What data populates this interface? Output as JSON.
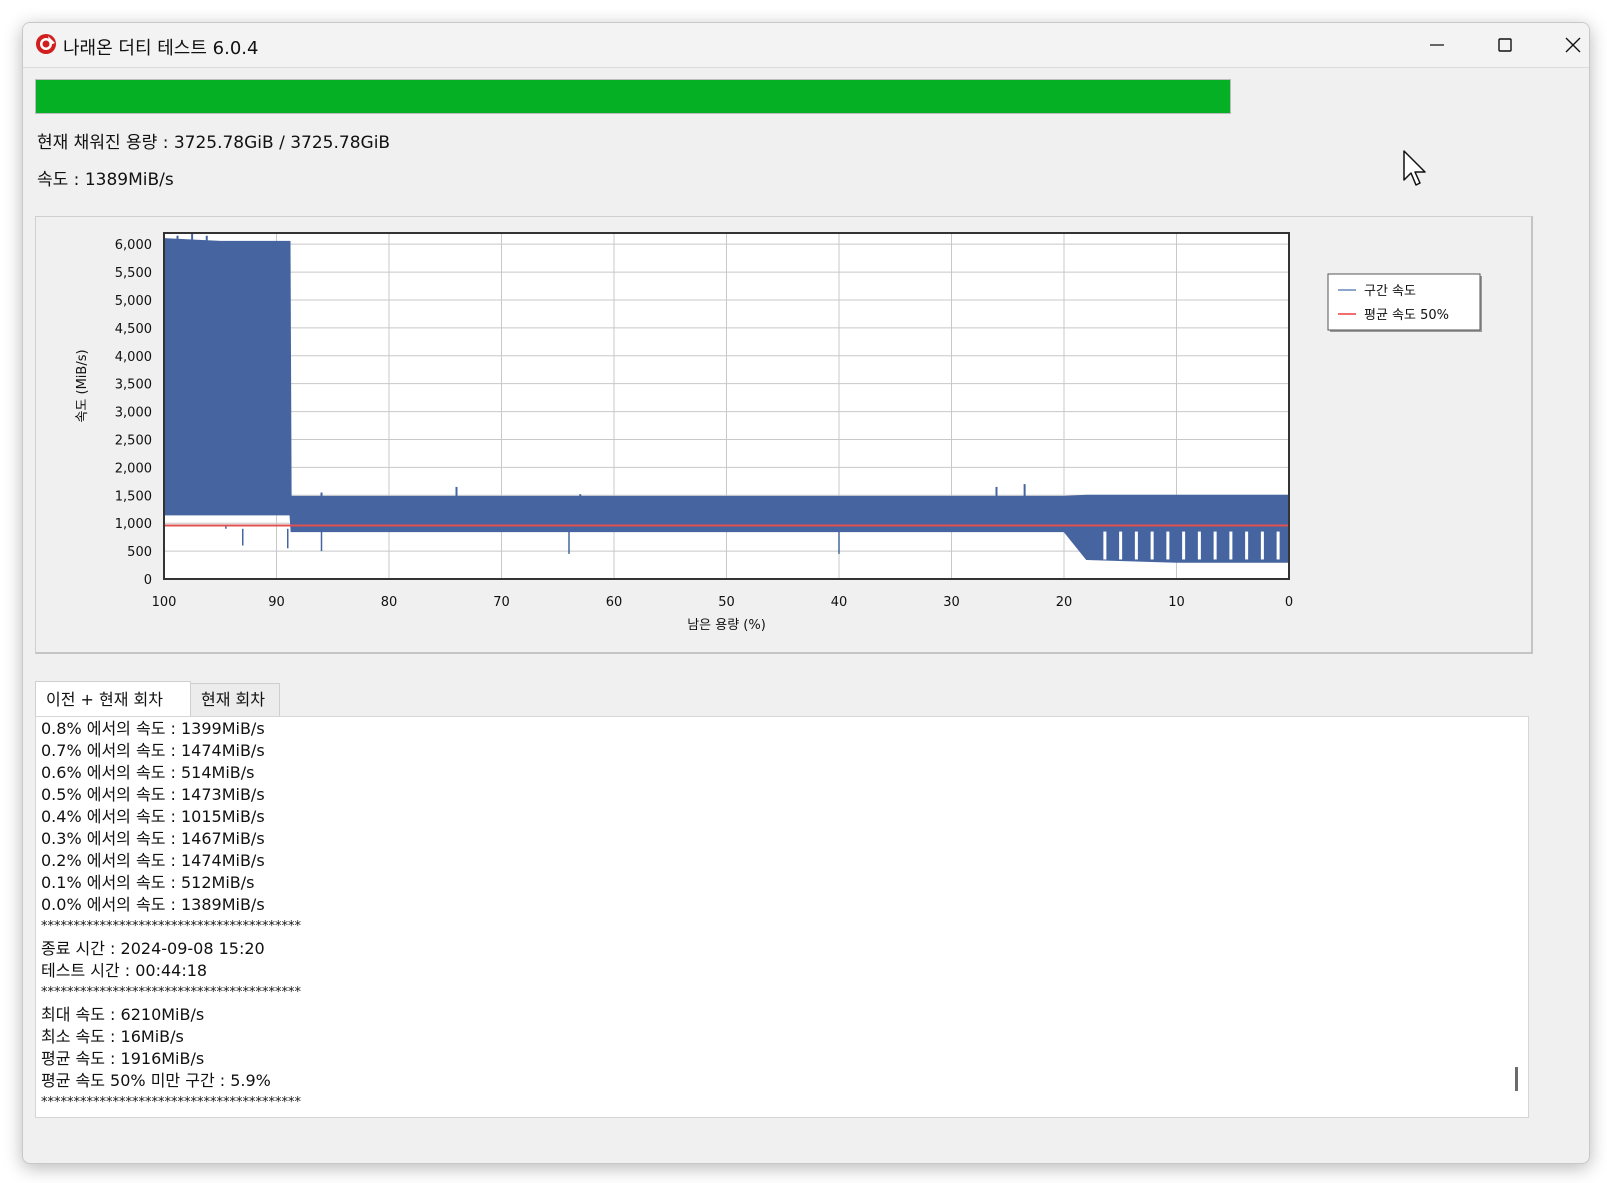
{
  "window": {
    "title": "나래온 더티 테스트 6.0.4"
  },
  "progress": {
    "value_fraction": 1.0,
    "color": "#06b025"
  },
  "info": {
    "capacity": "현재 채워진 용량 : 3725.78GiB / 3725.78GiB",
    "speed": "속도 : 1389MiB/s"
  },
  "chart_data": {
    "type": "area",
    "xlabel": "남은 용량 (%)",
    "ylabel": "속도 (MiB/s)",
    "xlim": [
      100,
      0
    ],
    "ylim": [
      0,
      6200
    ],
    "x_ticks": [
      "100",
      "90",
      "80",
      "70",
      "60",
      "50",
      "40",
      "30",
      "20",
      "10",
      "0"
    ],
    "y_ticks": [
      "0",
      "500",
      "1,000",
      "1,500",
      "2,000",
      "2,500",
      "3,000",
      "3,500",
      "4,000",
      "4,500",
      "5,000",
      "5,500",
      "6,000"
    ],
    "grid": true,
    "legend_position": "right",
    "series": [
      {
        "name": "구간 속도",
        "color": "#4665a0",
        "points": [
          {
            "x": 100,
            "low": 1150,
            "high": 6100
          },
          {
            "x": 95,
            "low": 1150,
            "high": 6050
          },
          {
            "x": 90,
            "low": 1150,
            "high": 6050
          },
          {
            "x": 88.8,
            "low": 1150,
            "high": 6050
          },
          {
            "x": 88.7,
            "low": 850,
            "high": 1480
          },
          {
            "x": 80,
            "low": 850,
            "high": 1480
          },
          {
            "x": 60,
            "low": 850,
            "high": 1480
          },
          {
            "x": 40,
            "low": 850,
            "high": 1480
          },
          {
            "x": 20,
            "low": 850,
            "high": 1480
          },
          {
            "x": 18,
            "low": 350,
            "high": 1500
          },
          {
            "x": 10,
            "low": 300,
            "high": 1500
          },
          {
            "x": 0,
            "low": 300,
            "high": 1500
          }
        ]
      },
      {
        "name": "평균 속도 50%",
        "color": "#e05050",
        "values": [
          {
            "x": 100,
            "y": 958
          },
          {
            "x": 0,
            "y": 958
          }
        ]
      }
    ]
  },
  "tabs": [
    {
      "label": "이전 + 현재 회차",
      "active": true
    },
    {
      "label": "현재 회차",
      "active": false
    }
  ],
  "log": [
    "0.8% 에서의 속도 : 1399MiB/s",
    "0.7% 에서의 속도 : 1474MiB/s",
    "0.6% 에서의 속도 : 514MiB/s",
    "0.5% 에서의 속도 : 1473MiB/s",
    "0.4% 에서의 속도 : 1015MiB/s",
    "0.3% 에서의 속도 : 1467MiB/s",
    "0.2% 에서의 속도 : 1474MiB/s",
    "0.1% 에서의 속도 : 512MiB/s",
    "0.0% 에서의 속도 : 1389MiB/s",
    "****************************************",
    "종료 시간 : 2024-09-08 15:20",
    "테스트 시간 : 00:44:18",
    "****************************************",
    "최대 속도 : 6210MiB/s",
    "최소 속도 : 16MiB/s",
    "평균 속도 : 1916MiB/s",
    "평균 속도 50% 미만 구간 : 5.9%",
    "****************************************"
  ]
}
